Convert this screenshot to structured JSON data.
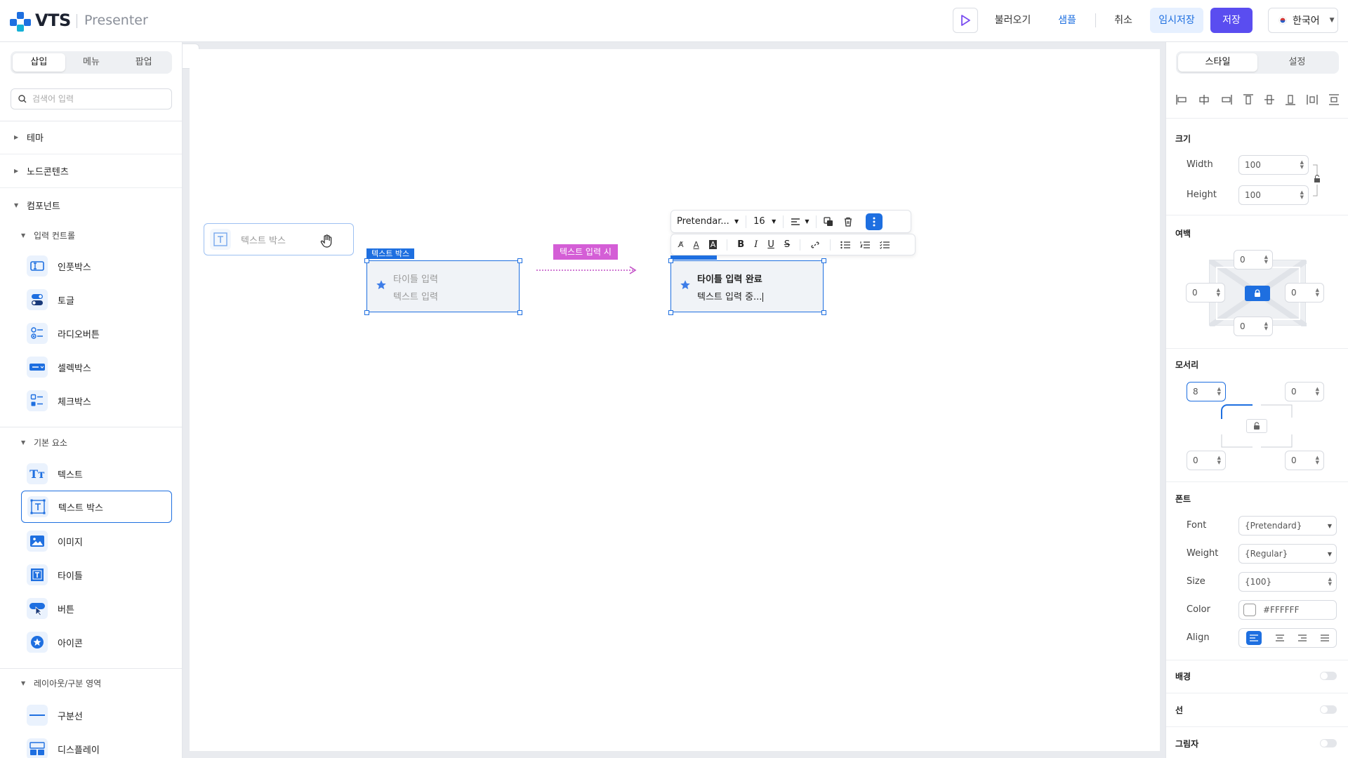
{
  "header": {
    "brand": "VTS",
    "app_name": "Presenter",
    "buttons": {
      "load": "불러오기",
      "sample": "샘플",
      "cancel": "취소",
      "temp_save": "임시저장",
      "save": "저장"
    },
    "language": "한국어"
  },
  "left": {
    "tabs": [
      "삽입",
      "메뉴",
      "팝업"
    ],
    "search_placeholder": "검색어 입력",
    "sections": {
      "theme": "테마",
      "node": "노드콘텐츠",
      "component": "컴포넌트"
    },
    "input_group": {
      "title": "입력 컨트롤",
      "items": [
        "인풋박스",
        "토글",
        "라디오버튼",
        "셀렉박스",
        "체크박스"
      ]
    },
    "basic_group": {
      "title": "기본 요소",
      "items": [
        "텍스트",
        "텍스트 박스",
        "이미지",
        "타이틀",
        "버튼",
        "아이콘"
      ]
    },
    "layout_group": {
      "title": "레이아웃/구분 영역",
      "items": [
        "구분선",
        "디스플레이"
      ]
    }
  },
  "canvas": {
    "drag_item": "텍스트 박스",
    "box1": {
      "tag": "텍스트 박스",
      "title": "타이틀 입력",
      "text": "텍스트 입력"
    },
    "arrow_label": "텍스트 입력 시",
    "box2": {
      "title": "타이틀 입력 완료",
      "text": "텍스트 입력 중..."
    },
    "toolbar": {
      "font": "Pretendar...",
      "size": "16"
    }
  },
  "right": {
    "tabs": [
      "스타일",
      "설정"
    ],
    "size": {
      "title": "크기",
      "width_label": "Width",
      "width": "100",
      "height_label": "Height",
      "height": "100"
    },
    "margin": {
      "title": "여백",
      "top": "0",
      "left": "0",
      "right": "0",
      "bottom": "0"
    },
    "corner": {
      "title": "모서리",
      "tl": "8",
      "tr": "0",
      "bl": "0",
      "br": "0"
    },
    "font": {
      "title": "폰트",
      "font_label": "Font",
      "font": "{Pretendard}",
      "weight_label": "Weight",
      "weight": "{Regular}",
      "size_label": "Size",
      "size": "{100}",
      "color_label": "Color",
      "color": "#FFFFFF",
      "align_label": "Align"
    },
    "background": "배경",
    "line": "선",
    "shadow": "그림자"
  },
  "colors": {
    "accent": "#1e6fe0",
    "save": "#5a4df0",
    "temp": "#e6f0ff",
    "tag_pink": "#d45ed6"
  }
}
